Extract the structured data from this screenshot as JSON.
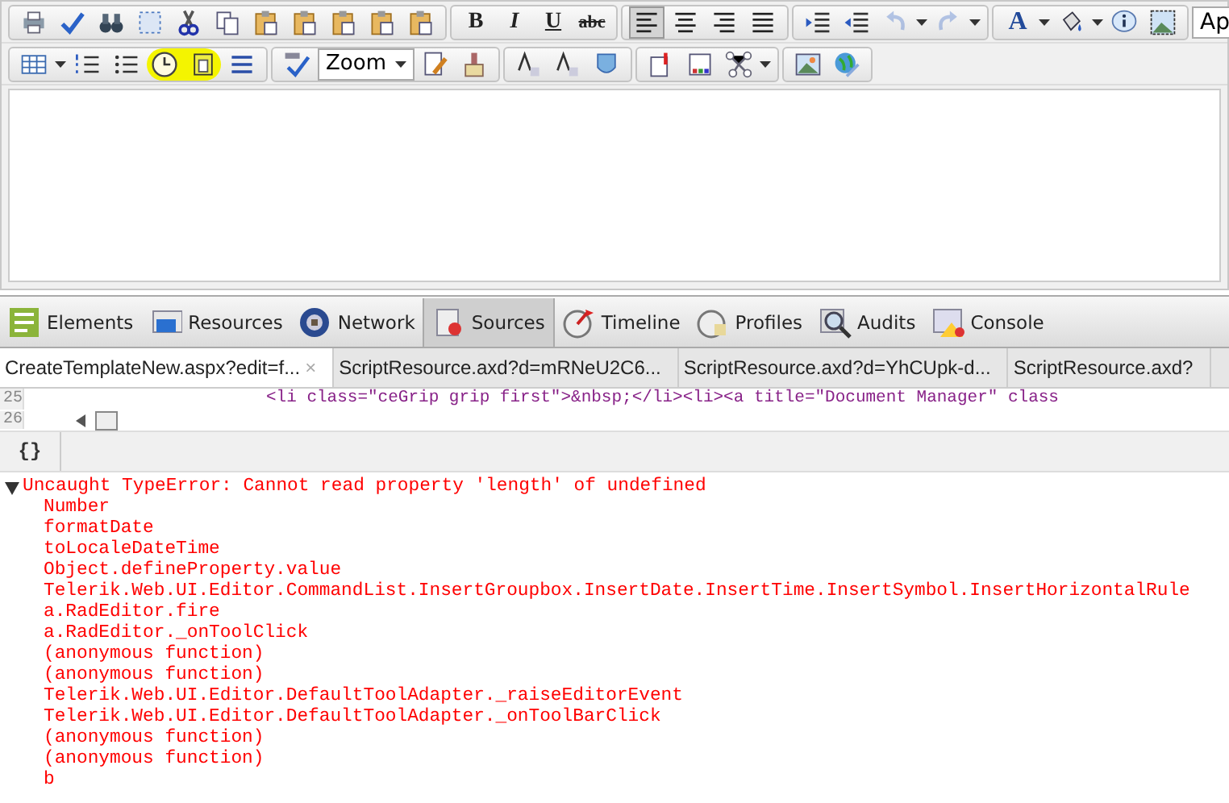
{
  "editor_toolbar": {
    "row_1": {
      "bold_label": "B",
      "italic_label": "I",
      "underline_label": "U",
      "strike_label": "abc",
      "alignments": [
        {
          "selected": true
        },
        {
          "selected": false
        },
        {
          "selected": false
        },
        {
          "selected": false
        }
      ],
      "undo_disabled": true,
      "redo_disabled": true,
      "font_color_label": "A",
      "font_field_value": "Ap"
    },
    "row_2": {
      "zoom_value": "Zoom",
      "highlighted": true
    }
  },
  "devtools": {
    "panel_tabs": [
      {
        "label": "Elements",
        "selected": false
      },
      {
        "label": "Resources",
        "selected": false
      },
      {
        "label": "Network",
        "selected": false
      },
      {
        "label": "Sources",
        "selected": true
      },
      {
        "label": "Timeline",
        "selected": false
      },
      {
        "label": "Profiles",
        "selected": false
      },
      {
        "label": "Audits",
        "selected": false
      },
      {
        "label": "Console",
        "selected": false
      }
    ],
    "file_tabs": [
      {
        "label": "CreateTemplateNew.aspx?edit=f...",
        "selected": true,
        "close": "×"
      },
      {
        "label": "ScriptResource.axd?d=mRNeU2C6...",
        "selected": false
      },
      {
        "label": "ScriptResource.axd?d=YhCUpk-d...",
        "selected": false
      },
      {
        "label": "ScriptResource.axd?",
        "selected": false
      }
    ],
    "code_lines": [
      {
        "number": "25",
        "text": "<li class=\"ceGrip grip first\">&nbsp;</li><li><a title=\"Document Manager\" class"
      },
      {
        "number": "26"
      }
    ],
    "pretty_print_label": "{}",
    "console": {
      "error": {
        "expanded": true,
        "message": "Uncaught TypeError: Cannot read property 'length' of undefined",
        "stack": [
          "Number",
          "formatDate",
          "toLocaleDateTime",
          "Object.defineProperty.value",
          "Telerik.Web.UI.Editor.CommandList.InsertGroupbox.InsertDate.InsertTime.InsertSymbol.InsertHorizontalRule",
          "a.RadEditor.fire",
          "a.RadEditor._onToolClick",
          "(anonymous function)",
          "(anonymous function)",
          "Telerik.Web.UI.Editor.DefaultToolAdapter._raiseEditorEvent",
          "Telerik.Web.UI.Editor.DefaultToolAdapter._onToolBarClick",
          "(anonymous function)",
          "(anonymous function)",
          "b"
        ]
      }
    }
  }
}
